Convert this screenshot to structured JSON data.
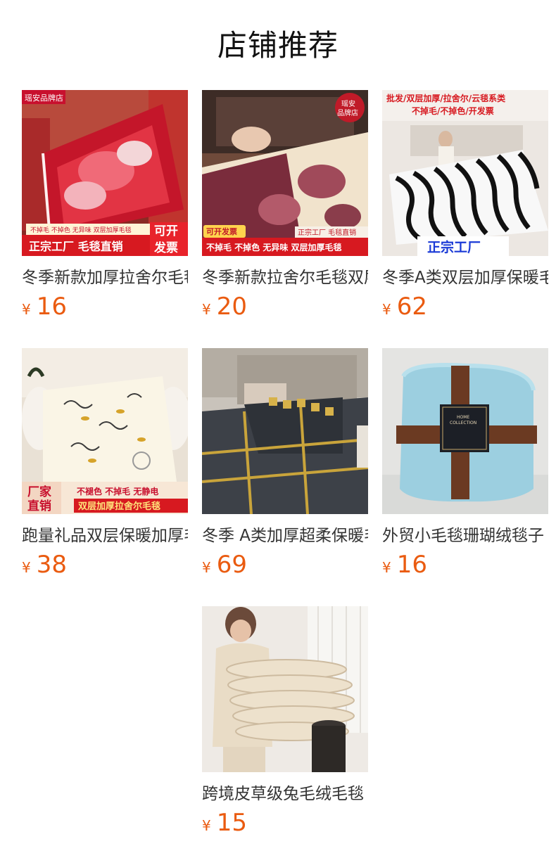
{
  "header": {
    "title": "店铺推荐"
  },
  "products": [
    {
      "name": "冬季新款加厚拉舍尔毛毯",
      "currency": "¥",
      "price": "16",
      "image": {
        "store_badge": "瑶安品牌店",
        "line1": "不掉毛 不掉色 无异味 双层加厚毛毯",
        "line2": "正宗工厂  毛毯直销",
        "side": "可开发票"
      }
    },
    {
      "name": "冬季新款拉舍尔毛毯双层加厚",
      "currency": "¥",
      "price": "20",
      "image": {
        "store_badge": "瑶安品牌店",
        "tag_left": "可开发票",
        "tag_right": "正宗工厂 毛毯直销",
        "line1": "不掉毛 不掉色 无异味 双层加厚毛毯"
      }
    },
    {
      "name": "冬季A类双层加厚保暖毛毯",
      "currency": "¥",
      "price": "62",
      "image": {
        "top1": "批发/双层加厚/拉舍尔/云毯系类",
        "top2": "不掉毛/不掉色/开发票",
        "bottom": "正宗工厂"
      }
    },
    {
      "name": "跑量礼品双层保暖加厚毛毯",
      "currency": "¥",
      "price": "38",
      "image": {
        "left": "厂家直销",
        "line1": "不褪色 不掉毛 无静电",
        "line2": "双层加厚拉舍尔毛毯"
      }
    },
    {
      "name": "冬季 A类加厚超柔保暖毛毯",
      "currency": "¥",
      "price": "69",
      "image": {}
    },
    {
      "name": "外贸小毛毯珊瑚绒毯子",
      "currency": "¥",
      "price": "16",
      "image": {
        "label1": "HOME",
        "label2": "COLLECTION"
      }
    },
    {
      "name": "跨境皮草级兔毛绒毛毯",
      "currency": "¥",
      "price": "15",
      "image": {}
    }
  ],
  "colors": {
    "price": "#ea5b10",
    "badge_red": "#d71920"
  }
}
